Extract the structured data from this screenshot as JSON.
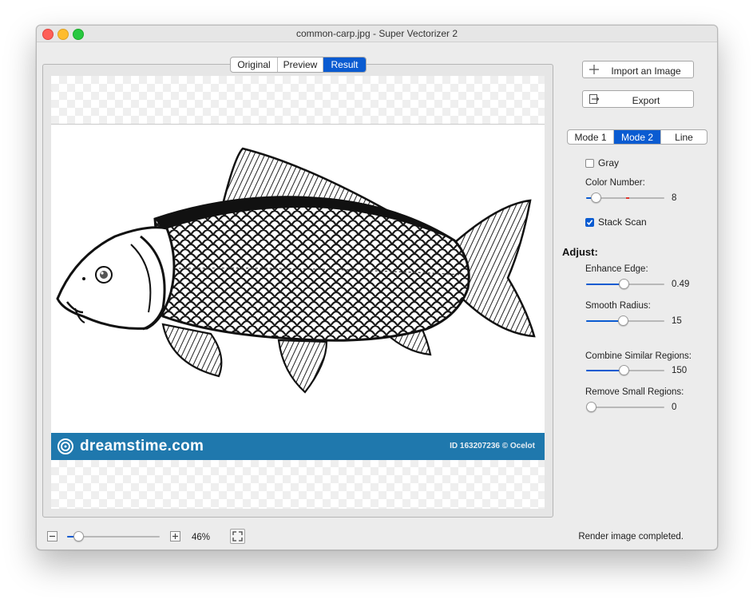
{
  "window": {
    "title": "common-carp.jpg - Super Vectorizer 2"
  },
  "view_tabs": {
    "items": [
      "Original",
      "Preview",
      "Result"
    ],
    "active": "Result"
  },
  "image": {
    "watermark_brand": "dreamstime.com",
    "watermark_id": "ID 163207236 © Ocelot"
  },
  "buttons": {
    "import_label": "Import an Image",
    "export_label": "Export"
  },
  "modes": {
    "items": [
      "Mode 1",
      "Mode 2",
      "Line"
    ],
    "active": "Mode 2"
  },
  "options": {
    "gray_label": "Gray",
    "gray_checked": false,
    "color_number_label": "Color Number:",
    "color_number_value": "8",
    "stack_scan_label": "Stack Scan",
    "stack_scan_checked": true
  },
  "adjust": {
    "title": "Adjust:",
    "enhance_edge_label": "Enhance Edge:",
    "enhance_edge_value": "0.49",
    "smooth_radius_label": "Smooth Radius:",
    "smooth_radius_value": "15",
    "combine_label": "Combine Similar Regions:",
    "combine_value": "150",
    "remove_label": "Remove Small Regions:",
    "remove_value": "0"
  },
  "zoom": {
    "level": "46%",
    "slider_fraction": 0.13
  },
  "slider_levels": {
    "color_number": 0.13,
    "enhance_edge": 0.49,
    "smooth_radius": 0.48,
    "combine_similar": 0.49,
    "remove_small": 0.0
  },
  "status": {
    "text": "Render image completed."
  },
  "colors": {
    "accent": "#0a5bd1",
    "banner": "#1f78ad"
  }
}
